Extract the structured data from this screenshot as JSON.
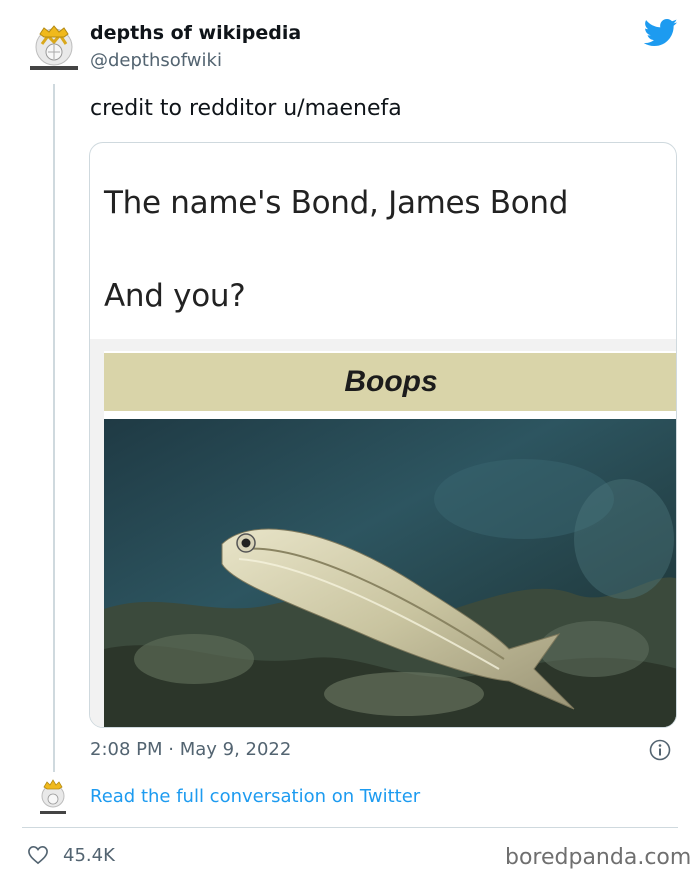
{
  "tweet": {
    "display_name": "depths of wikipedia",
    "handle": "@depthsofwiki",
    "text": "credit to redditor u/maenefa",
    "timestamp": "2:08 PM · May 9, 2022",
    "read_more": "Read the full conversation on Twitter",
    "likes": "45.4K"
  },
  "meme": {
    "line1": "The name's Bond, James Bond",
    "line2": "And you?",
    "banner": "Boops",
    "banner_color": "#d9d4a9"
  },
  "icons": {
    "avatar": "wikipedia-logo-crown-icon",
    "platform": "twitter-bird-icon",
    "info": "info-icon",
    "like": "heart-icon"
  },
  "colors": {
    "link": "#1d9bf0",
    "secondary_text": "#536471",
    "twitter_blue": "#1d9bf0"
  },
  "watermark": "boredpanda.com"
}
